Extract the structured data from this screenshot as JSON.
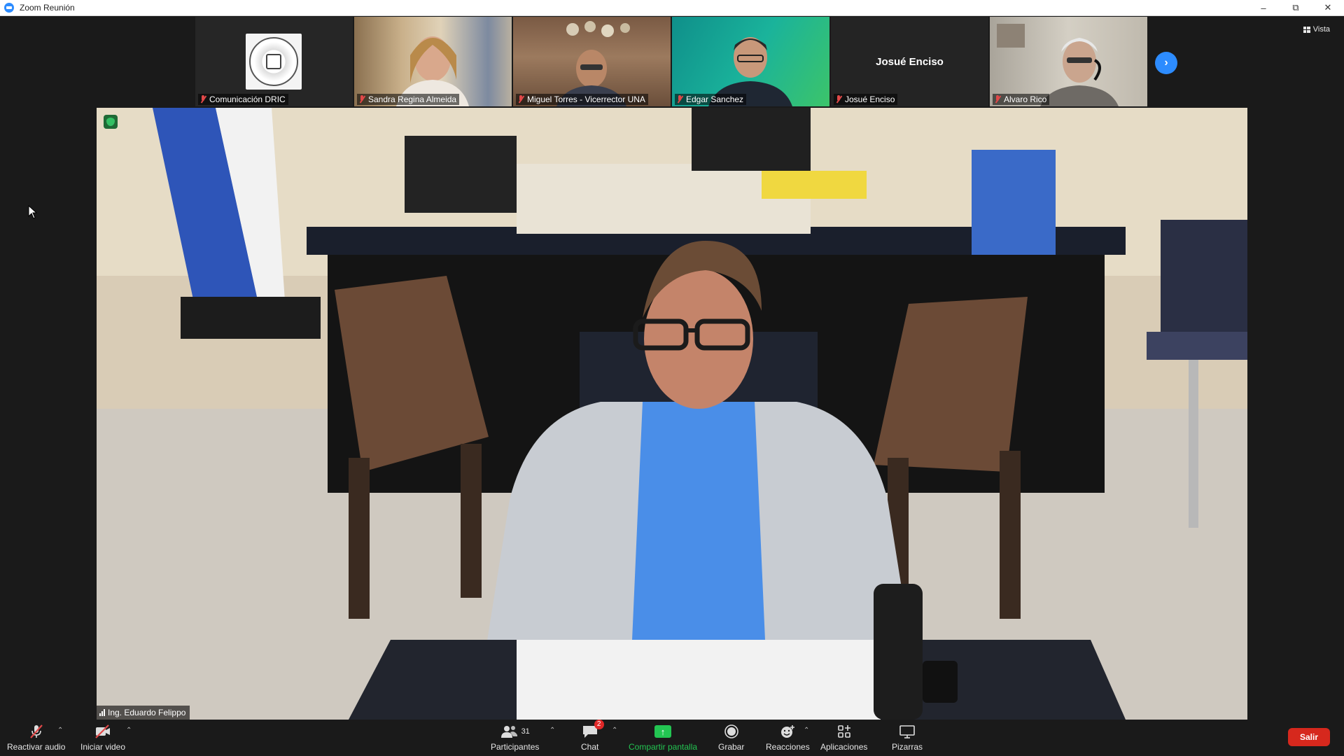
{
  "window": {
    "title": "Zoom Reunión"
  },
  "view": {
    "label": "Vista"
  },
  "participants_strip": [
    {
      "name": "Comunicación DRIC"
    },
    {
      "name": "Sandra Regina Almeida"
    },
    {
      "name": "Miguel Torres - Vicerrector UNA"
    },
    {
      "name": "Edgar Sanchez"
    },
    {
      "name": "Josué Enciso",
      "display_name": "Josué Enciso"
    },
    {
      "name": "Alvaro Rico"
    }
  ],
  "main_video": {
    "speaker_name": "Ing. Eduardo Felippo"
  },
  "toolbar": {
    "unmute_label": "Reactivar audio",
    "start_video_label": "Iniciar video",
    "participants_label": "Participantes",
    "participants_count": "31",
    "chat_label": "Chat",
    "chat_badge": "2",
    "share_label": "Compartir pantalla",
    "record_label": "Grabar",
    "reactions_label": "Reacciones",
    "apps_label": "Aplicaciones",
    "whiteboards_label": "Pizarras",
    "leave_label": "Salir"
  },
  "colors": {
    "accent": "#2d8cff",
    "share": "#23c552",
    "leave": "#d6281d",
    "mute": "#e04848"
  }
}
